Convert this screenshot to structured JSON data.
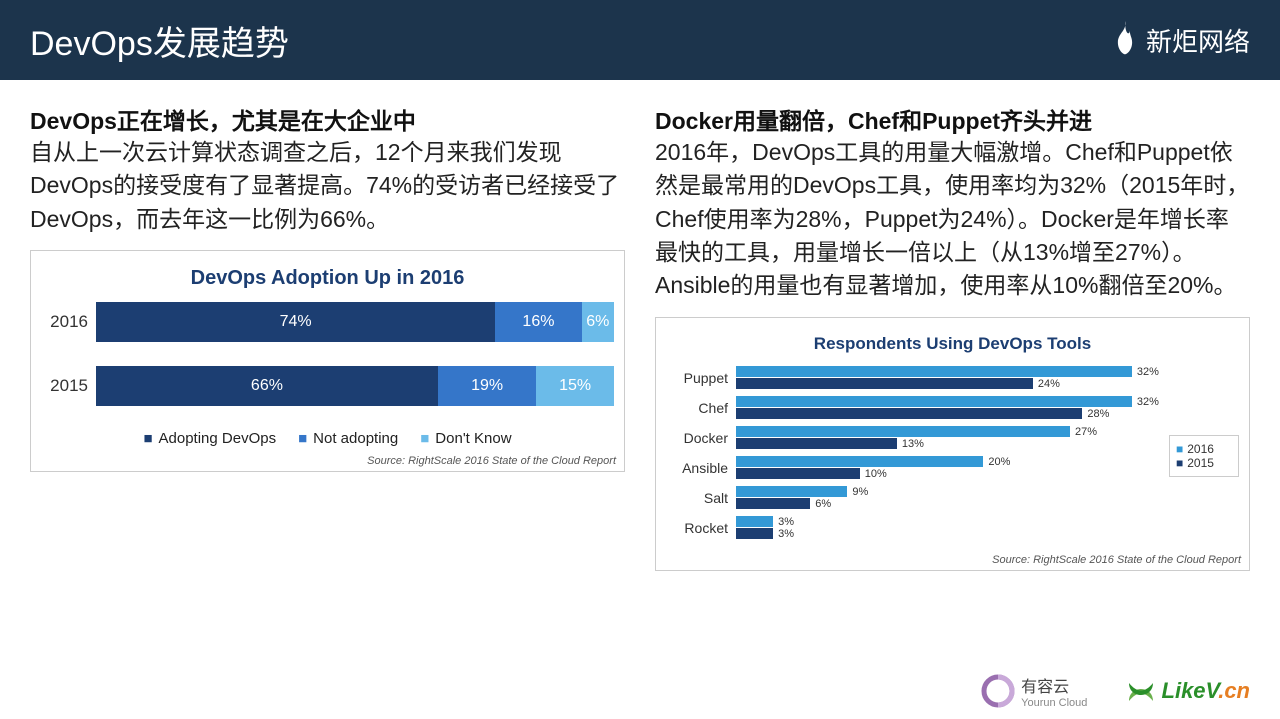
{
  "header": {
    "title": "DevOps发展趋势",
    "brand": "新炬网络"
  },
  "left": {
    "title": "DevOps正在增长，尤其是在大企业中",
    "text": "自从上一次云计算状态调查之后，12个月来我们发现DevOps的接受度有了显著提高。74%的受访者已经接受了DevOps，而去年这一比例为66%。"
  },
  "right": {
    "title": "Docker用量翻倍，Chef和Puppet齐头并进",
    "text": "2016年，DevOps工具的用量大幅激增。Chef和Puppet依然是最常用的DevOps工具，使用率均为32%（2015年时，Chef使用率为28%，Puppet为24%）。Docker是年增长率最快的工具，用量增长一倍以上（从13%增至27%）。Ansible的用量也有显著增加，使用率从10%翻倍至20%。"
  },
  "chart1": {
    "title": "DevOps Adoption Up in 2016",
    "legend": [
      "Adopting DevOps",
      "Not adopting",
      "Don't Know"
    ],
    "source": "Source: RightScale 2016 State of the Cloud Report"
  },
  "chart2": {
    "title": "Respondents Using DevOps Tools",
    "legend": [
      "2016",
      "2015"
    ],
    "source": "Source: RightScale 2016 State of the Cloud Report"
  },
  "footer": {
    "youruncloud": "有容云",
    "youruncloud_sub": "Yourun Cloud",
    "likev": "LikeV",
    "likev_cn": ".cn"
  },
  "chart_data": [
    {
      "type": "bar",
      "orientation": "horizontal-stacked",
      "title": "DevOps Adoption Up in 2016",
      "categories": [
        "2016",
        "2015"
      ],
      "series": [
        {
          "name": "Adopting DevOps",
          "values": [
            74,
            66
          ]
        },
        {
          "name": "Not adopting",
          "values": [
            16,
            19
          ]
        },
        {
          "name": "Don't Know",
          "values": [
            6,
            15
          ]
        }
      ],
      "xlabel": "",
      "ylabel": "",
      "unit": "%"
    },
    {
      "type": "bar",
      "orientation": "horizontal-grouped",
      "title": "Respondents Using DevOps Tools",
      "categories": [
        "Puppet",
        "Chef",
        "Docker",
        "Ansible",
        "Salt",
        "Rocket"
      ],
      "series": [
        {
          "name": "2016",
          "values": [
            32,
            32,
            27,
            20,
            9,
            3
          ]
        },
        {
          "name": "2015",
          "values": [
            24,
            28,
            13,
            10,
            6,
            3
          ]
        }
      ],
      "xlabel": "",
      "ylabel": "",
      "xlim": [
        0,
        35
      ],
      "unit": "%"
    }
  ]
}
